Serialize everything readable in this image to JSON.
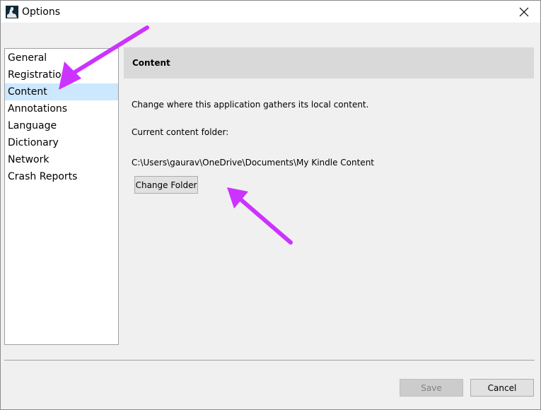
{
  "window": {
    "title": "Options",
    "app_icon": "kindle-reader-icon",
    "close_icon": "close-icon"
  },
  "nav": {
    "items": [
      {
        "label": "General"
      },
      {
        "label": "Registration"
      },
      {
        "label": "Content"
      },
      {
        "label": "Annotations"
      },
      {
        "label": "Language"
      },
      {
        "label": "Dictionary"
      },
      {
        "label": "Network"
      },
      {
        "label": "Crash Reports"
      }
    ],
    "selected": "Content"
  },
  "panel": {
    "title": "Content",
    "description": "Change where this application gathers its local content.",
    "current_label": "Current content folder:",
    "folder_path": "C:\\Users\\gaurav\\OneDrive\\Documents\\My Kindle Content",
    "change_button": "Change Folder"
  },
  "footer": {
    "save_label": "Save",
    "cancel_label": "Cancel"
  },
  "colors": {
    "selection": "#cce8ff",
    "header_bg": "#d9d9d9",
    "annotation_arrow": "#cc33ff"
  }
}
